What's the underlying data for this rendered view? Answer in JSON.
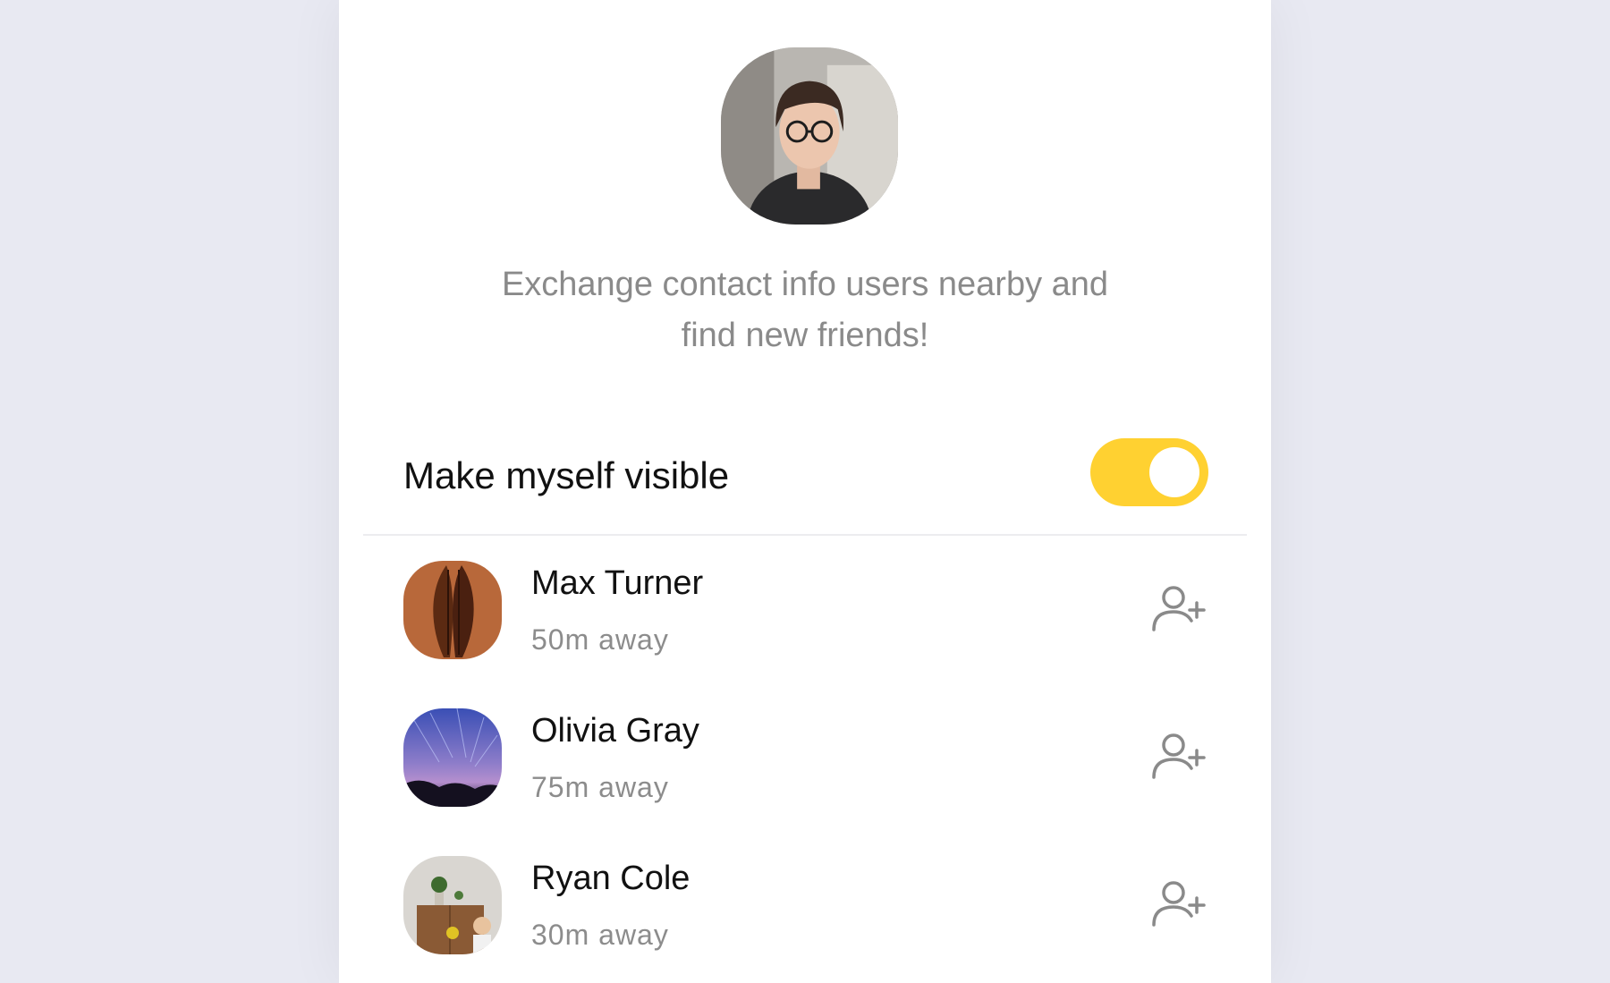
{
  "intro": {
    "line1": "Exchange contact info users nearby and",
    "line2": "find new friends!"
  },
  "visibility": {
    "label": "Make myself visible",
    "enabled": true,
    "accent_color": "#FFD131"
  },
  "nearby": [
    {
      "name": "Max Turner",
      "distance": "50m away",
      "icon": "add-user-icon"
    },
    {
      "name": "Olivia Gray",
      "distance": "75m away",
      "icon": "add-user-icon"
    },
    {
      "name": "Ryan Cole",
      "distance": "30m away",
      "icon": "add-user-icon"
    }
  ]
}
